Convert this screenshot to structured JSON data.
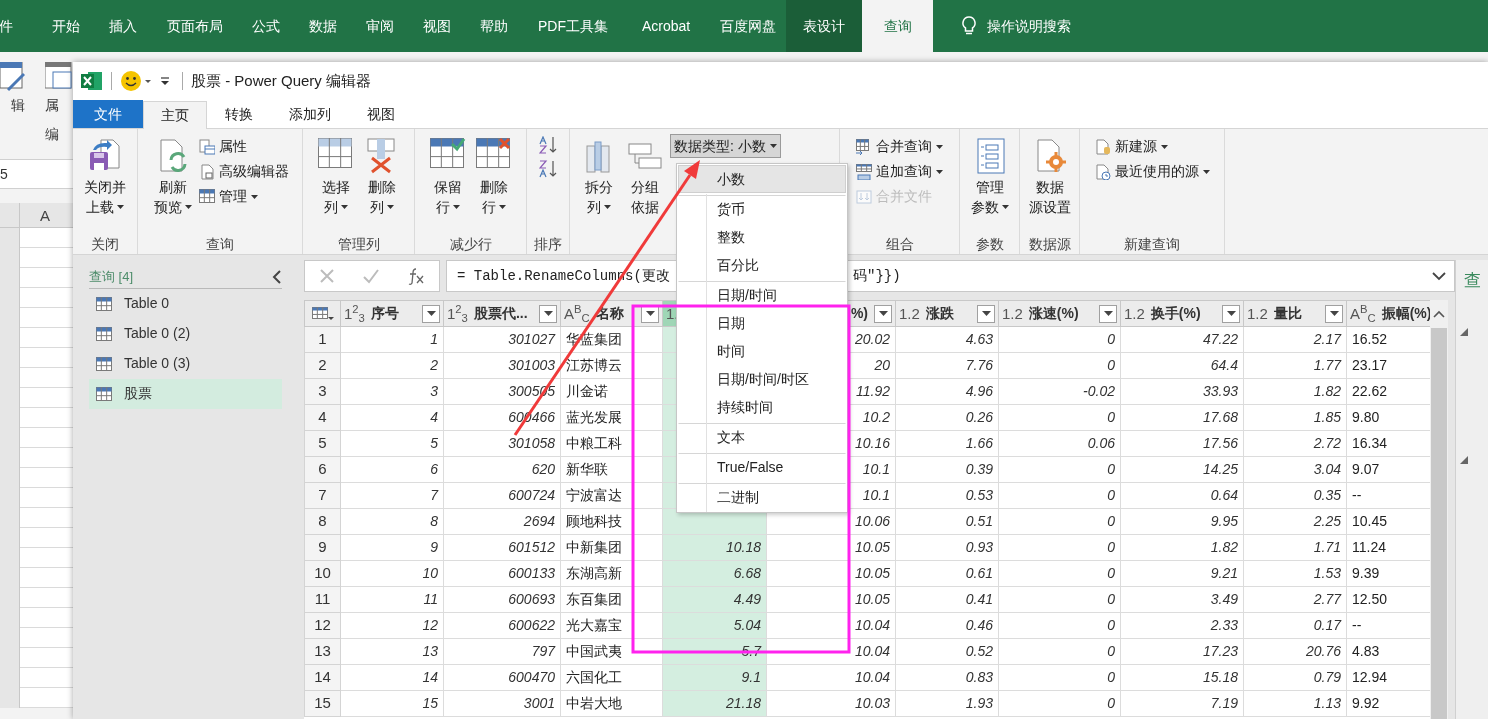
{
  "excel": {
    "tabs": [
      {
        "label": "件",
        "selected": false,
        "contextual": false
      },
      {
        "label": "开始",
        "selected": false,
        "contextual": false
      },
      {
        "label": "插入",
        "selected": false,
        "contextual": false
      },
      {
        "label": "页面布局",
        "selected": false,
        "contextual": false
      },
      {
        "label": "公式",
        "selected": false,
        "contextual": false
      },
      {
        "label": "数据",
        "selected": false,
        "contextual": false
      },
      {
        "label": "审阅",
        "selected": false,
        "contextual": false
      },
      {
        "label": "视图",
        "selected": false,
        "contextual": false
      },
      {
        "label": "帮助",
        "selected": false,
        "contextual": false
      },
      {
        "label": "PDF工具集",
        "selected": false,
        "contextual": false
      },
      {
        "label": "Acrobat",
        "selected": false,
        "contextual": false
      },
      {
        "label": "百度网盘",
        "selected": false,
        "contextual": false
      },
      {
        "label": "表设计",
        "selected": false,
        "contextual": true
      },
      {
        "label": "查询",
        "selected": true,
        "contextual": false
      }
    ],
    "search": "操作说明搜索",
    "ribbon_buttons": [
      "辑",
      "属"
    ],
    "ribbon_group": "编",
    "name_box": "5",
    "column_header": "A"
  },
  "window": {
    "title": "股票 - Power Query 编辑器"
  },
  "tabs": [
    {
      "label": "文件",
      "kind": "file",
      "selected": false
    },
    {
      "label": "主页",
      "kind": "tab",
      "selected": true
    },
    {
      "label": "转换",
      "kind": "tab",
      "selected": false
    },
    {
      "label": "添加列",
      "kind": "tab",
      "selected": false
    },
    {
      "label": "视图",
      "kind": "tab",
      "selected": false
    }
  ],
  "ribbon": {
    "groups": [
      {
        "label": "关闭",
        "buttons": [
          {
            "kind": "large",
            "lines": [
              "关闭并",
              "上载"
            ],
            "dropdown": true
          }
        ]
      },
      {
        "label": "查询",
        "buttons": [
          {
            "kind": "large",
            "lines": [
              "刷新",
              "预览"
            ],
            "dropdown": true
          },
          {
            "kind": "small",
            "label": "属性",
            "dropdown": false
          },
          {
            "kind": "small",
            "label": "高级编辑器",
            "dropdown": false
          },
          {
            "kind": "small",
            "label": "管理",
            "dropdown": true
          }
        ]
      },
      {
        "label": "管理列",
        "buttons": [
          {
            "kind": "large",
            "lines": [
              "选择",
              "列"
            ],
            "dropdown": true
          },
          {
            "kind": "large",
            "lines": [
              "删除",
              "列"
            ],
            "dropdown": true
          }
        ]
      },
      {
        "label": "减少行",
        "buttons": [
          {
            "kind": "large",
            "lines": [
              "保留",
              "行"
            ],
            "dropdown": true
          },
          {
            "kind": "large",
            "lines": [
              "删除",
              "行"
            ],
            "dropdown": true
          }
        ]
      },
      {
        "label": "排序",
        "buttons": [
          {
            "kind": "icon"
          },
          {
            "kind": "icon"
          }
        ]
      },
      {
        "buttons": [
          {
            "kind": "large",
            "lines": [
              "拆分",
              "列"
            ],
            "dropdown": true
          },
          {
            "kind": "large",
            "lines": [
              "分组",
              "依据"
            ],
            "dropdown": false
          },
          {
            "kind": "datatype",
            "label": "数据类型: 小数",
            "dropdown": true,
            "pressed": true
          }
        ]
      },
      {
        "label": "组合",
        "buttons": [
          {
            "kind": "small",
            "label": "合并查询",
            "dropdown": true
          },
          {
            "kind": "small",
            "label": "追加查询",
            "dropdown": true
          },
          {
            "kind": "small",
            "label": "合并文件",
            "dropdown": false,
            "disabled": true
          }
        ]
      },
      {
        "label": "参数",
        "buttons": [
          {
            "kind": "large",
            "lines": [
              "管理",
              "参数"
            ],
            "dropdown": true
          }
        ]
      },
      {
        "label": "数据源",
        "buttons": [
          {
            "kind": "large",
            "lines": [
              "数据",
              "源设置"
            ],
            "dropdown": false
          }
        ]
      },
      {
        "label": "新建查询",
        "buttons": [
          {
            "kind": "small",
            "label": "新建源",
            "dropdown": true
          },
          {
            "kind": "small",
            "label": "最近使用的源",
            "dropdown": true
          }
        ]
      }
    ]
  },
  "menu": {
    "items": [
      {
        "label": "小数",
        "selected": true,
        "separator_before": false
      },
      {
        "label": "货币",
        "selected": false,
        "separator_before": true
      },
      {
        "label": "整数",
        "selected": false,
        "separator_before": false
      },
      {
        "label": "百分比",
        "selected": false,
        "separator_before": false
      },
      {
        "label": "日期/时间",
        "selected": false,
        "separator_before": true
      },
      {
        "label": "日期",
        "selected": false,
        "separator_before": false
      },
      {
        "label": "时间",
        "selected": false,
        "separator_before": false
      },
      {
        "label": "日期/时间/时区",
        "selected": false,
        "separator_before": false
      },
      {
        "label": "持续时间",
        "selected": false,
        "separator_before": false
      },
      {
        "label": "文本",
        "selected": false,
        "separator_before": true
      },
      {
        "label": "True/False",
        "selected": false,
        "separator_before": true
      },
      {
        "label": "二进制",
        "selected": false,
        "separator_before": true
      }
    ]
  },
  "queries": {
    "title": "查询 [4]",
    "items": [
      {
        "label": "Table 0",
        "selected": false
      },
      {
        "label": "Table 0 (2)",
        "selected": false
      },
      {
        "label": "Table 0 (3)",
        "selected": false
      },
      {
        "label": "股票",
        "selected": true
      }
    ]
  },
  "formula": {
    "start": "= Table.RenameColumns(更改",
    "end": "码\"}})"
  },
  "side_panel": {
    "label": "查"
  },
  "table": {
    "columns": [
      {
        "type": "1$^{2}$$_{3}$",
        "label": "序号",
        "kind": "number",
        "selected": false
      },
      {
        "type": "1$^{2}$$_{3}$",
        "label": "股票代...",
        "kind": "number",
        "selected": false
      },
      {
        "type": "A$^{B}$$_{C}$",
        "label": "名称",
        "kind": "text",
        "selected": false
      },
      {
        "type": "1.",
        "kind": "number",
        "selected": true
      },
      {
        "label": "%)",
        "kind": "number",
        "selected": false
      },
      {
        "type": "1.2",
        "label": "涨跌",
        "kind": "number",
        "selected": false
      },
      {
        "type": "1.2",
        "label": "涨速(%)",
        "kind": "number",
        "selected": false
      },
      {
        "type": "1.2",
        "label": "换手(%)",
        "kind": "number",
        "selected": false
      },
      {
        "type": "1.2",
        "label": "量比",
        "kind": "number",
        "selected": false
      },
      {
        "type": "A$^{B}$$_{C}$",
        "label": "振幅(%)",
        "kind": "text",
        "selected": false
      }
    ],
    "rows": [
      {
        "n": "1",
        "cells": [
          "1",
          "301027",
          "华蓝集团",
          null,
          "20.02",
          "4.63",
          "0",
          "47.22",
          "2.17",
          "16.52"
        ]
      },
      {
        "n": "2",
        "cells": [
          "2",
          "301003",
          "江苏博云",
          null,
          "20",
          "7.76",
          "0",
          "64.4",
          "1.77",
          "23.17"
        ]
      },
      {
        "n": "3",
        "cells": [
          "3",
          "300505",
          "川金诺",
          null,
          "11.92",
          "4.96",
          "-0.02",
          "33.93",
          "1.82",
          "22.62"
        ]
      },
      {
        "n": "4",
        "cells": [
          "4",
          "600466",
          "蓝光发展",
          null,
          "10.2",
          "0.26",
          "0",
          "17.68",
          "1.85",
          "9.80"
        ]
      },
      {
        "n": "5",
        "cells": [
          "5",
          "301058",
          "中粮工科",
          null,
          "10.16",
          "1.66",
          "0.06",
          "17.56",
          "2.72",
          "16.34"
        ]
      },
      {
        "n": "6",
        "cells": [
          "6",
          "620",
          "新华联",
          null,
          "10.1",
          "0.39",
          "0",
          "14.25",
          "3.04",
          "9.07"
        ]
      },
      {
        "n": "7",
        "cells": [
          "7",
          "600724",
          "宁波富达",
          null,
          "10.1",
          "0.53",
          "0",
          "0.64",
          "0.35",
          "--"
        ]
      },
      {
        "n": "8",
        "cells": [
          "8",
          "2694",
          "顾地科技",
          null,
          "10.06",
          "0.51",
          "0",
          "9.95",
          "2.25",
          "10.45"
        ]
      },
      {
        "n": "9",
        "cells": [
          "9",
          "601512",
          "中新集团",
          "10.18",
          "10.05",
          "0.93",
          "0",
          "1.82",
          "1.71",
          "11.24"
        ]
      },
      {
        "n": "10",
        "cells": [
          "10",
          "600133",
          "东湖高新",
          "6.68",
          "10.05",
          "0.61",
          "0",
          "9.21",
          "1.53",
          "9.39"
        ]
      },
      {
        "n": "11",
        "cells": [
          "11",
          "600693",
          "东百集团",
          "4.49",
          "10.05",
          "0.41",
          "0",
          "3.49",
          "2.77",
          "12.50"
        ]
      },
      {
        "n": "12",
        "cells": [
          "12",
          "600622",
          "光大嘉宝",
          "5.04",
          "10.04",
          "0.46",
          "0",
          "2.33",
          "0.17",
          "--"
        ]
      },
      {
        "n": "13",
        "cells": [
          "13",
          "797",
          "中国武夷",
          "5.7",
          "10.04",
          "0.52",
          "0",
          "17.23",
          "20.76",
          "4.83"
        ]
      },
      {
        "n": "14",
        "cells": [
          "14",
          "600470",
          "六国化工",
          "9.1",
          "10.04",
          "0.83",
          "0",
          "15.18",
          "0.79",
          "12.94"
        ]
      },
      {
        "n": "15",
        "cells": [
          "15",
          "3001",
          "中岩大地",
          "21.18",
          "10.03",
          "1.93",
          "0",
          "7.19",
          "1.13",
          "9.92"
        ]
      }
    ]
  }
}
